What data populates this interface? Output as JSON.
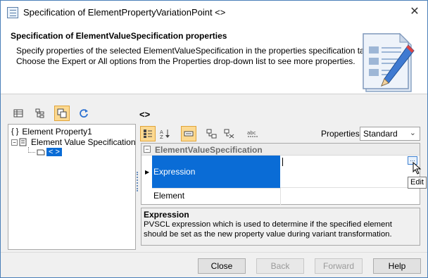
{
  "window": {
    "title": "Specification of ElementPropertyVariationPoint <>",
    "close_glyph": "✕"
  },
  "header": {
    "title": "Specification of ElementValueSpecification properties",
    "description_line1": "Specify properties of the selected ElementValueSpecification in the properties specification table.",
    "description_line2": "Choose the Expert or All options from the Properties drop-down list to see more properties.",
    "icon": "document-pencil-icon"
  },
  "left_toolbar": {
    "icons": [
      "list-view-icon",
      "tree-view-icon",
      "copy-element-icon",
      "refresh-icon"
    ]
  },
  "tree": {
    "items": [
      {
        "prefix": "{ }",
        "label": "Element Property1"
      },
      {
        "prefix": "⊟",
        "label": "Element Value Specification"
      },
      {
        "prefix": "",
        "label": "< >"
      }
    ]
  },
  "element_title": "<>",
  "right_toolbar": {
    "icons": [
      "categorized-icon",
      "sort-alpha-icon",
      "show-inherited-icon",
      "expand-all-icon",
      "collapse-all-icon",
      "abc-filter-icon"
    ],
    "properties_label": "Properties:",
    "properties_value": "Standard"
  },
  "grid": {
    "group": "ElementValueSpecification",
    "rows": [
      {
        "name": "Expression",
        "value": ""
      },
      {
        "name": "Element",
        "value": ""
      }
    ],
    "edit_glyph": "...",
    "tooltip": "Edit"
  },
  "description": {
    "title": "Expression",
    "text": "PVSCL expression which is used to determine if the specified element should be set as the new property value during variant transformation."
  },
  "buttons": {
    "close": "Close",
    "back": "Back",
    "forward": "Forward",
    "help": "Help"
  },
  "colors": {
    "selection": "#0a6cd6",
    "active_button": "#fcd991",
    "window_border": "#4a7fb8"
  }
}
